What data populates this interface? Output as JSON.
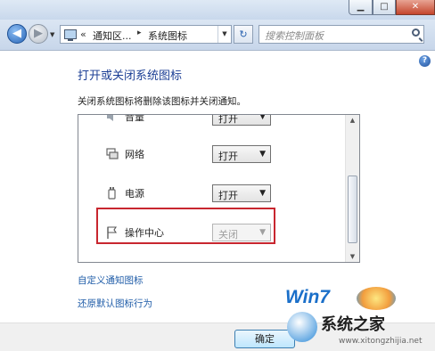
{
  "navbar": {
    "breadcrumb_sep": "«",
    "crumb1": "通知区...",
    "crumb_arrow": "▸",
    "crumb2": "系统图标",
    "search_placeholder": "搜索控制面板"
  },
  "content": {
    "title": "打开或关闭系统图标",
    "subtitle": "关闭系统图标将删除该图标并关闭通知。",
    "rows": [
      {
        "label": "音量",
        "value": "打开",
        "icon": "volume-icon"
      },
      {
        "label": "网络",
        "value": "打开",
        "icon": "network-icon"
      },
      {
        "label": "电源",
        "value": "打开",
        "icon": "power-icon"
      },
      {
        "label": "操作中心",
        "value": "关闭",
        "icon": "flag-icon",
        "disabled": true
      }
    ],
    "link1": "自定义通知图标",
    "link2": "还原默认图标行为",
    "ok_label": "确定"
  },
  "watermark": {
    "brand": "Win7",
    "site": "系统之家",
    "url": "www.xitongzhijia.net"
  },
  "colors": {
    "title_blue": "#1c3f95",
    "link_blue": "#1f5ca8",
    "highlight_red": "#c8262f"
  }
}
